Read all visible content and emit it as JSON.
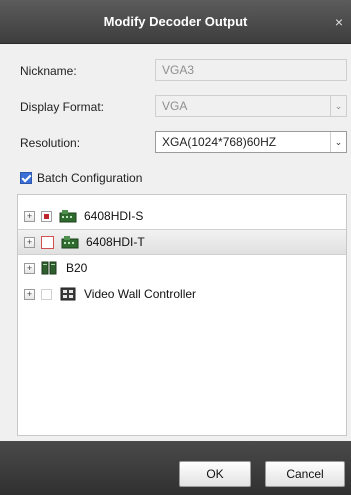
{
  "dialog": {
    "title": "Modify Decoder Output",
    "close_glyph": "×"
  },
  "form": {
    "nickname_label": "Nickname:",
    "nickname_value": "VGA3",
    "display_format_label": "Display Format:",
    "display_format_value": "VGA",
    "resolution_label": "Resolution:",
    "resolution_value": "XGA(1024*768)60HZ",
    "batch_label": "Batch Configuration",
    "batch_checked": true
  },
  "tree": {
    "items": [
      {
        "label": "6408HDI-S",
        "check": "partial",
        "icon": "decoder-icon"
      },
      {
        "label": "6408HDI-T",
        "check": "unchecked",
        "icon": "decoder-icon",
        "selected": true
      },
      {
        "label": "B20",
        "check": "none",
        "icon": "controller-icon"
      },
      {
        "label": "Video Wall Controller",
        "check": "unchecked",
        "icon": "videowall-icon"
      }
    ]
  },
  "footer": {
    "ok_label": "OK",
    "cancel_label": "Cancel"
  },
  "colors": {
    "titlebar": "#4a4a4a",
    "footer": "#3a3a3a",
    "check_accent": "#c0272d",
    "batch_accent": "#3a6fd8"
  }
}
